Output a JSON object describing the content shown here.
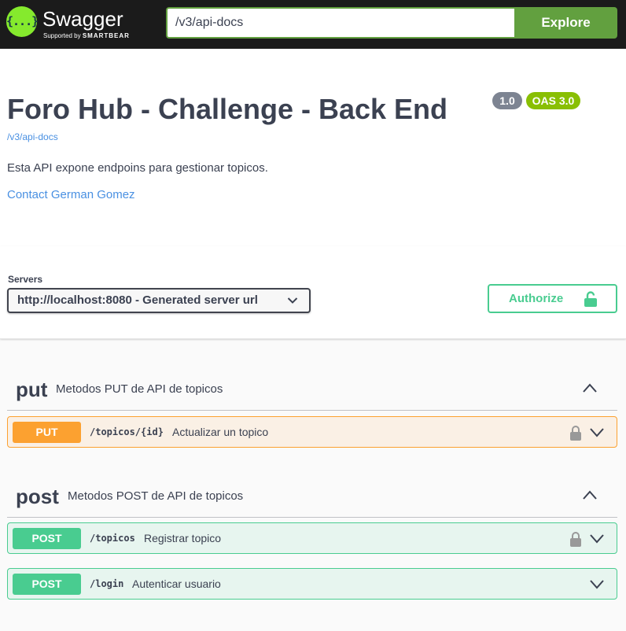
{
  "topbar": {
    "logo_glyph": "{...}",
    "logo_text": "Swagger",
    "logo_sub_prefix": "Supported by",
    "logo_sub_brand": "SMARTBEAR",
    "url_value": "/v3/api-docs",
    "explore_label": "Explore",
    "accent_color": "#85ea2d",
    "button_color": "#62a03f"
  },
  "info": {
    "title": "Foro Hub - Challenge - Back End",
    "version": "1.0",
    "oas": "OAS 3.0",
    "api_link": "/v3/api-docs",
    "description": "Esta API expone endpoins para gestionar topicos.",
    "contact": "Contact German Gomez"
  },
  "schemes": {
    "servers_label": "Servers",
    "selected_server": "http://localhost:8080 - Generated server url",
    "authorize_label": "Authorize"
  },
  "tags": [
    {
      "name": "put",
      "description": "Metodos PUT de API de topicos",
      "operations": [
        {
          "method": "PUT",
          "path": "/topicos/{id}",
          "summary": "Actualizar un topico",
          "locked": true
        }
      ]
    },
    {
      "name": "post",
      "description": "Metodos POST de API de topicos",
      "operations": [
        {
          "method": "POST",
          "path": "/topicos",
          "summary": "Registrar topico",
          "locked": true
        },
        {
          "method": "POST",
          "path": "/login",
          "summary": "Autenticar usuario",
          "locked": false
        }
      ]
    }
  ],
  "colors": {
    "put": "#fca130",
    "post": "#49cc90",
    "link": "#4990e2",
    "version_badge": "#7d8492",
    "oas_badge": "#89bf04"
  },
  "icons": {
    "server_select": "chevron-down-icon",
    "authorize": "lock-open-icon",
    "tag_toggle": "chevron-up-icon",
    "operation_lock": "lock-icon",
    "operation_toggle": "chevron-down-icon"
  }
}
